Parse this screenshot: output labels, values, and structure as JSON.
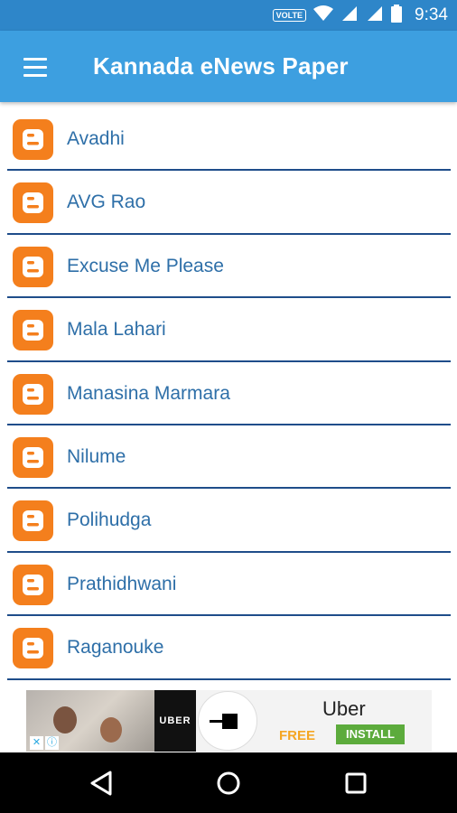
{
  "status_bar": {
    "volte": "VOLTE",
    "time": "9:34"
  },
  "toolbar": {
    "title": "Kannada eNews Paper",
    "menu_icon": "hamburger-menu-icon"
  },
  "list": {
    "item_icon": "blogger-icon",
    "items": [
      {
        "label": "Avadhi"
      },
      {
        "label": "AVG Rao"
      },
      {
        "label": "Excuse Me Please"
      },
      {
        "label": "Mala Lahari"
      },
      {
        "label": "Manasina Marmara"
      },
      {
        "label": "Nilume"
      },
      {
        "label": "Polihudga"
      },
      {
        "label": "Prathidhwani"
      },
      {
        "label": "Raganouke"
      }
    ]
  },
  "ad": {
    "brand_logo": "UBER",
    "title": "Uber",
    "price": "FREE",
    "cta": "INSTALL"
  },
  "colors": {
    "status_bar": "#2e86c9",
    "toolbar": "#3d9fe0",
    "icon_orange": "#f47f1d",
    "item_text": "#2e6fa8",
    "divider": "#1f4d8a"
  }
}
